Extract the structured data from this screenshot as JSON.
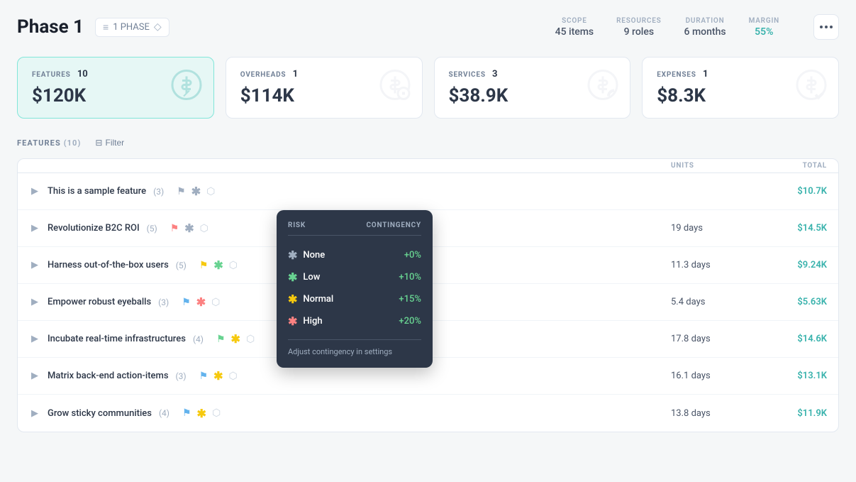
{
  "header": {
    "title": "Phase 1",
    "phase_label": "1 PHASE",
    "more_button_label": "...",
    "stats": {
      "scope_label": "SCOPE",
      "scope_value": "45 items",
      "resources_label": "RESOURCES",
      "resources_value": "9 roles",
      "duration_label": "DURATION",
      "duration_value": "6 months",
      "margin_label": "MARGIN",
      "margin_value": "55%"
    }
  },
  "cards": [
    {
      "label": "FEATURES",
      "count": "10",
      "amount": "$120K",
      "icon": "💰",
      "active": true
    },
    {
      "label": "OVERHEADS",
      "count": "1",
      "amount": "$114K",
      "icon": "💰",
      "active": false
    },
    {
      "label": "SERVICES",
      "count": "3",
      "amount": "$38.9K",
      "icon": "💰",
      "active": false
    },
    {
      "label": "EXPENSES",
      "count": "1",
      "amount": "$8.3K",
      "icon": "💰",
      "active": false
    }
  ],
  "features_section": {
    "title": "FEATURES",
    "count": 10,
    "filter_label": "Filter",
    "columns": {
      "name": "",
      "units_label": "UNITS",
      "total_label": "TOTAL"
    }
  },
  "rows": [
    {
      "name": "This is a sample feature",
      "sub_count": 3,
      "flag_color": "#a0aec0",
      "risk_color": "#a0aec0",
      "units": "",
      "total": "$10.7K"
    },
    {
      "name": "Revolutionize B2C ROI",
      "sub_count": 5,
      "flag_color": "#fc8181",
      "risk_color": "#a0aec0",
      "units": "19 days",
      "total": "$14.5K"
    },
    {
      "name": "Harness out-of-the-box users",
      "sub_count": 5,
      "flag_color": "#f6c90e",
      "risk_color": "#68d391",
      "units": "11.3 days",
      "total": "$9.24K"
    },
    {
      "name": "Empower robust eyeballs",
      "sub_count": 3,
      "flag_color": "#63b3ed",
      "risk_color": "#fc8181",
      "units": "5.4 days",
      "total": "$5.63K"
    },
    {
      "name": "Incubate real-time infrastructures",
      "sub_count": 4,
      "flag_color": "#68d391",
      "risk_color": "#f6c90e",
      "units": "17.8 days",
      "total": "$14.6K"
    },
    {
      "name": "Matrix back-end action-items",
      "sub_count": 3,
      "flag_color": "#63b3ed",
      "risk_color": "#f6c90e",
      "units": "16.1 days",
      "total": "$13.1K"
    },
    {
      "name": "Grow sticky communities",
      "sub_count": 4,
      "flag_color": "#63b3ed",
      "risk_color": "#f6c90e",
      "units": "13.8 days",
      "total": "$11.9K"
    }
  ],
  "risk_popup": {
    "risk_col_label": "RISK",
    "contingency_col_label": "CONTINGENCY",
    "options": [
      {
        "name": "None",
        "contingency": "+0%",
        "risk_class": "risk-none"
      },
      {
        "name": "Low",
        "contingency": "+10%",
        "risk_class": "risk-low"
      },
      {
        "name": "Normal",
        "contingency": "+15%",
        "risk_class": "risk-normal"
      },
      {
        "name": "High",
        "contingency": "+20%",
        "risk_class": "risk-high"
      }
    ],
    "footer_text": "Adjust contingency in settings"
  }
}
